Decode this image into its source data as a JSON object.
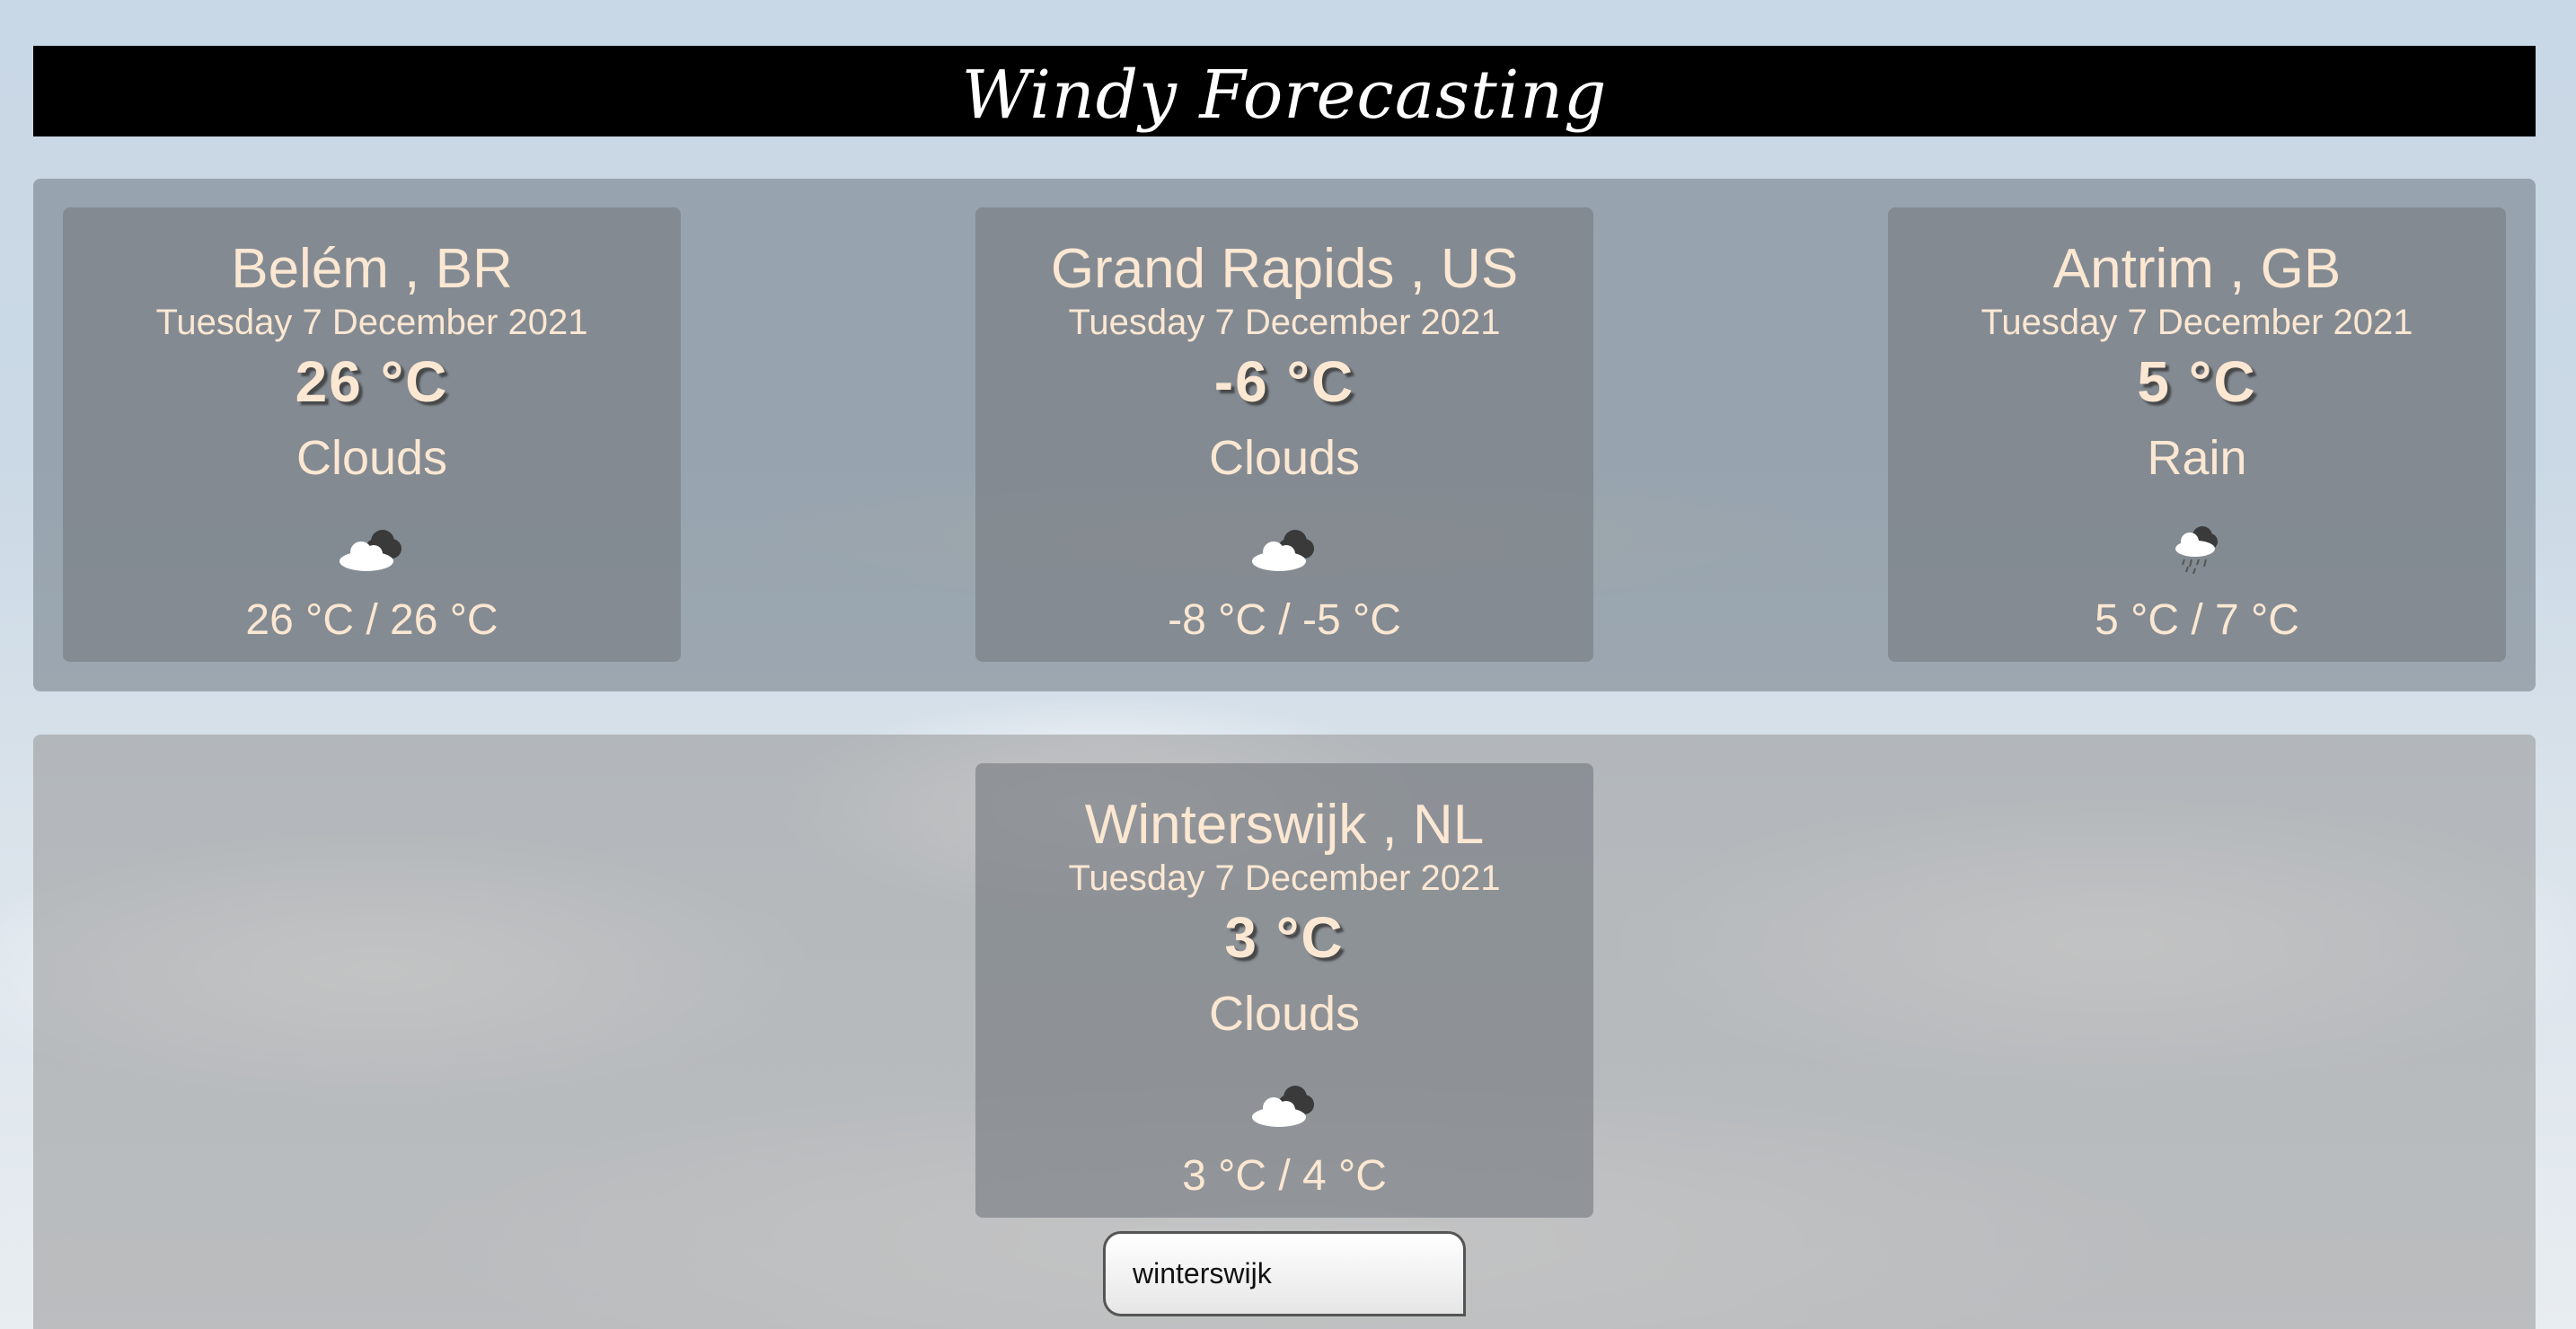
{
  "header": {
    "title": "Windy Forecasting"
  },
  "top_cards": [
    {
      "city": "Belém , BR",
      "date": "Tuesday 7 December 2021",
      "temp": "26 °C",
      "condition": "Clouds",
      "icon": "clouds-icon",
      "range": "26 °C / 26 °C"
    },
    {
      "city": "Grand Rapids , US",
      "date": "Tuesday 7 December 2021",
      "temp": "-6 °C",
      "condition": "Clouds",
      "icon": "clouds-icon",
      "range": "-8 °C / -5 °C"
    },
    {
      "city": "Antrim , GB",
      "date": "Tuesday 7 December 2021",
      "temp": "5 °C",
      "condition": "Rain",
      "icon": "rain-cloud-icon",
      "range": "5 °C / 7 °C"
    }
  ],
  "main_card": {
    "city": "Winterswijk , NL",
    "date": "Tuesday 7 December 2021",
    "temp": "3 °C",
    "condition": "Clouds",
    "icon": "clouds-icon",
    "range": "3 °C / 4 °C"
  },
  "search": {
    "value": "winterswijk"
  },
  "colors": {
    "header_bg": "#000000",
    "card_text": "#fbe7d2"
  }
}
